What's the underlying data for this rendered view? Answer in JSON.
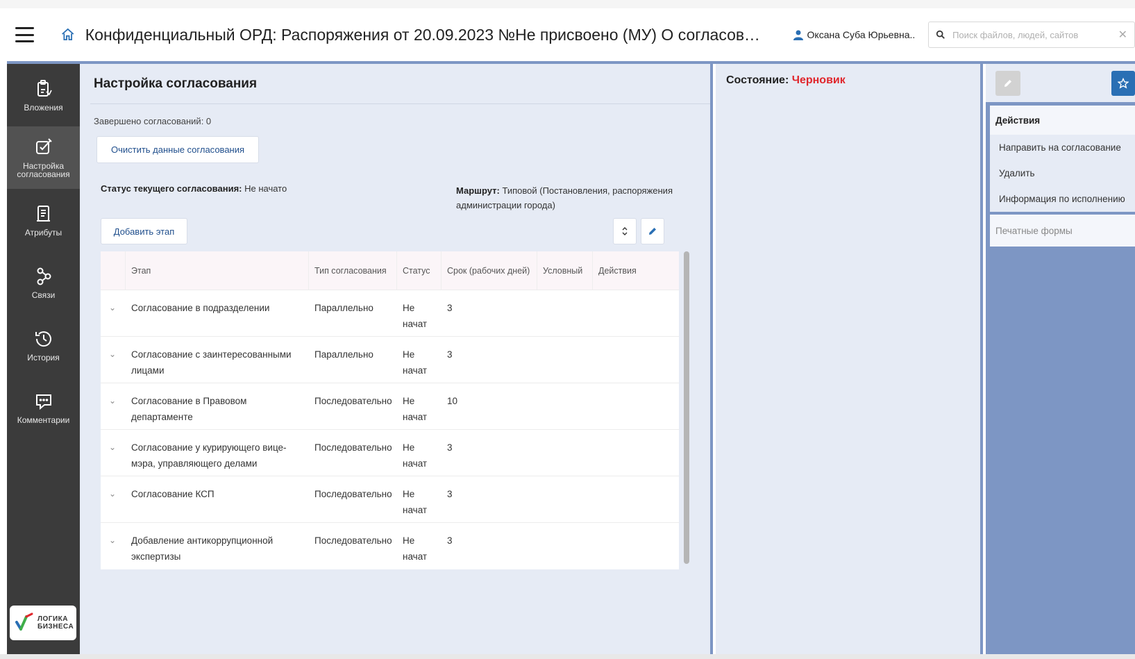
{
  "header": {
    "title": "Конфиденциальный ОРД: Распоряжения от 20.09.2023 №Не присвоено (МУ) О согласовании пе...",
    "user": "Оксана Суба Юрьевна...",
    "search_placeholder": "Поиск файлов, людей, сайтов",
    "search_value": ""
  },
  "sidebar": {
    "items": [
      {
        "label": "Вложения",
        "icon": "clipboard-icon",
        "active": false
      },
      {
        "label": "Настройка согласования",
        "icon": "edit-check-icon",
        "active": true
      },
      {
        "label": "Атрибуты",
        "icon": "document-list-icon",
        "active": false
      },
      {
        "label": "Связи",
        "icon": "links-icon",
        "active": false
      },
      {
        "label": "История",
        "icon": "history-icon",
        "active": false
      },
      {
        "label": "Комментарии",
        "icon": "comment-icon",
        "active": false
      }
    ],
    "logo_line1": "ЛОГИКА",
    "logo_line2": "БИЗНЕСА"
  },
  "main": {
    "title": "Настройка согласования",
    "completed": "Завершено согласований: 0",
    "clear_button": "Очистить данные согласования",
    "status_label": "Статус текущего согласования:",
    "status_value": "Не начато",
    "route_label": "Маршрут:",
    "route_value": "Типовой (Постановления, распоряжения администрации города)",
    "add_stage_button": "Добавить этап",
    "table": {
      "headers": [
        "Этап",
        "Тип согласования",
        "Статус",
        "Срок (рабочих дней)",
        "Условный",
        "Действия"
      ],
      "rows": [
        {
          "stage": "Согласование в подразделении",
          "type": "Параллельно",
          "status": "Не начат",
          "term": "3",
          "conditional": "",
          "actions": ""
        },
        {
          "stage": "Согласование с заинтересованными лицами",
          "type": "Параллельно",
          "status": "Не начат",
          "term": "3",
          "conditional": "",
          "actions": ""
        },
        {
          "stage": "Согласование в Правовом департаменте",
          "type": "Последовательно",
          "status": "Не начат",
          "term": "10",
          "conditional": "",
          "actions": ""
        },
        {
          "stage": "Согласование у курирующего вице-мэра, управляющего делами",
          "type": "Последовательно",
          "status": "Не начат",
          "term": "3",
          "conditional": "",
          "actions": ""
        },
        {
          "stage": "Согласование КСП",
          "type": "Последовательно",
          "status": "Не начат",
          "term": "3",
          "conditional": "",
          "actions": ""
        },
        {
          "stage": "Добавление антикоррупционной экспертизы",
          "type": "Последовательно",
          "status": "Не начат",
          "term": "3",
          "conditional": "",
          "actions": ""
        }
      ]
    }
  },
  "state": {
    "label": "Состояние:",
    "value": "Черновик",
    "value_color": "#e0262c"
  },
  "actions_panel": {
    "header": "Действия",
    "items": [
      "Направить на согласование",
      "Удалить",
      "Информация по исполнению"
    ],
    "print_forms": "Печатные формы"
  },
  "colors": {
    "accent": "#2a6fb4",
    "sidebar_bg": "#3b3b3b",
    "panel_bg": "#e6ebf5",
    "border_blue": "#7d96c4"
  }
}
